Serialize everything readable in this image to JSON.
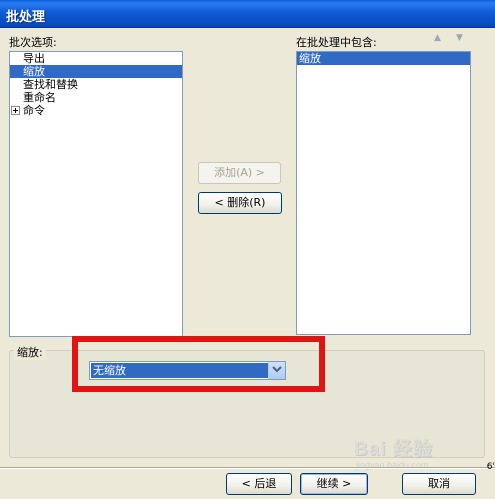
{
  "window": {
    "title": "批处理"
  },
  "left_panel": {
    "label": "批次选项:",
    "items": [
      {
        "label": "导出",
        "selected": false,
        "expandable": false
      },
      {
        "label": "缩放",
        "selected": true,
        "expandable": false
      },
      {
        "label": "查找和替换",
        "selected": false,
        "expandable": false
      },
      {
        "label": "重命名",
        "selected": false,
        "expandable": false
      },
      {
        "label": "命令",
        "selected": false,
        "expandable": true
      }
    ]
  },
  "right_panel": {
    "label": "在批处理中包含:",
    "move_up_icon": "triangle-up",
    "move_down_icon": "triangle-down",
    "items": [
      {
        "label": "缩放",
        "selected": true
      }
    ]
  },
  "middle_buttons": {
    "add_label": "添加(A) >",
    "add_enabled": false,
    "remove_label": "< 删除(R)"
  },
  "scale_group": {
    "title": "缩放:",
    "dropdown_value": "无缩放"
  },
  "footer": {
    "back_label": "< 后退",
    "next_label": "继续 >",
    "cancel_label": "取消"
  },
  "watermark": {
    "text": "Bai 经验",
    "sub": "jingyan.baidu.com"
  },
  "edge_text": "6'",
  "colors": {
    "highlight": "#316ac5",
    "title_bar": "#0a4fc4",
    "annotation": "#e11414",
    "dialog_bg": "#ece9d8"
  }
}
